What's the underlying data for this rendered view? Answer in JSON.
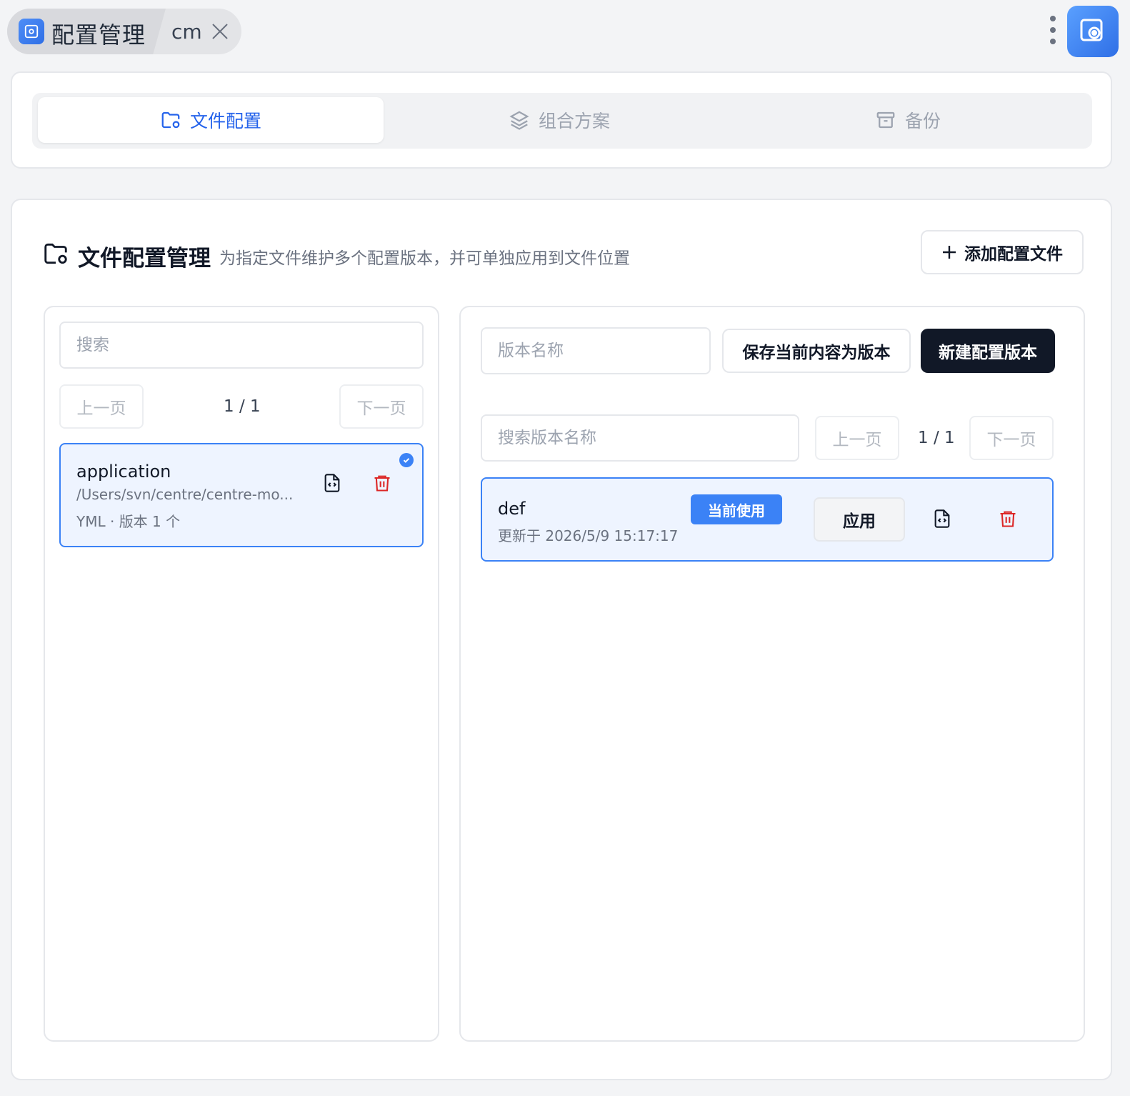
{
  "titlebar": {
    "app_title": "配置管理",
    "tab_sub": "cm"
  },
  "nav": {
    "tabs": [
      {
        "label": "文件配置",
        "icon": "folder-gear-icon",
        "active": true
      },
      {
        "label": "组合方案",
        "icon": "layers-icon",
        "active": false
      },
      {
        "label": "备份",
        "icon": "archive-icon",
        "active": false
      }
    ]
  },
  "section": {
    "title": "文件配置管理",
    "description": "为指定文件维护多个配置版本，并可单独应用到文件位置",
    "add_button": "添加配置文件"
  },
  "file_list": {
    "search_placeholder": "搜索",
    "prev_label": "上一页",
    "next_label": "下一页",
    "page_label": "1 / 1",
    "items": [
      {
        "name": "application",
        "path": "/Users/svn/centre/centre-mo...",
        "meta": "YML · 版本 1 个",
        "selected": true
      }
    ]
  },
  "versions": {
    "name_placeholder": "版本名称",
    "save_button": "保存当前内容为版本",
    "new_button": "新建配置版本",
    "search_placeholder": "搜索版本名称",
    "prev_label": "上一页",
    "next_label": "下一页",
    "page_label": "1 / 1",
    "items": [
      {
        "name": "def",
        "updated": "更新于 2026/5/9 15:17:17",
        "badge": "当前使用",
        "apply_label": "应用"
      }
    ]
  },
  "colors": {
    "accent": "#2563eb",
    "selected_bg": "#eef4ff",
    "danger": "#dc2626",
    "dark_button": "#111827"
  }
}
